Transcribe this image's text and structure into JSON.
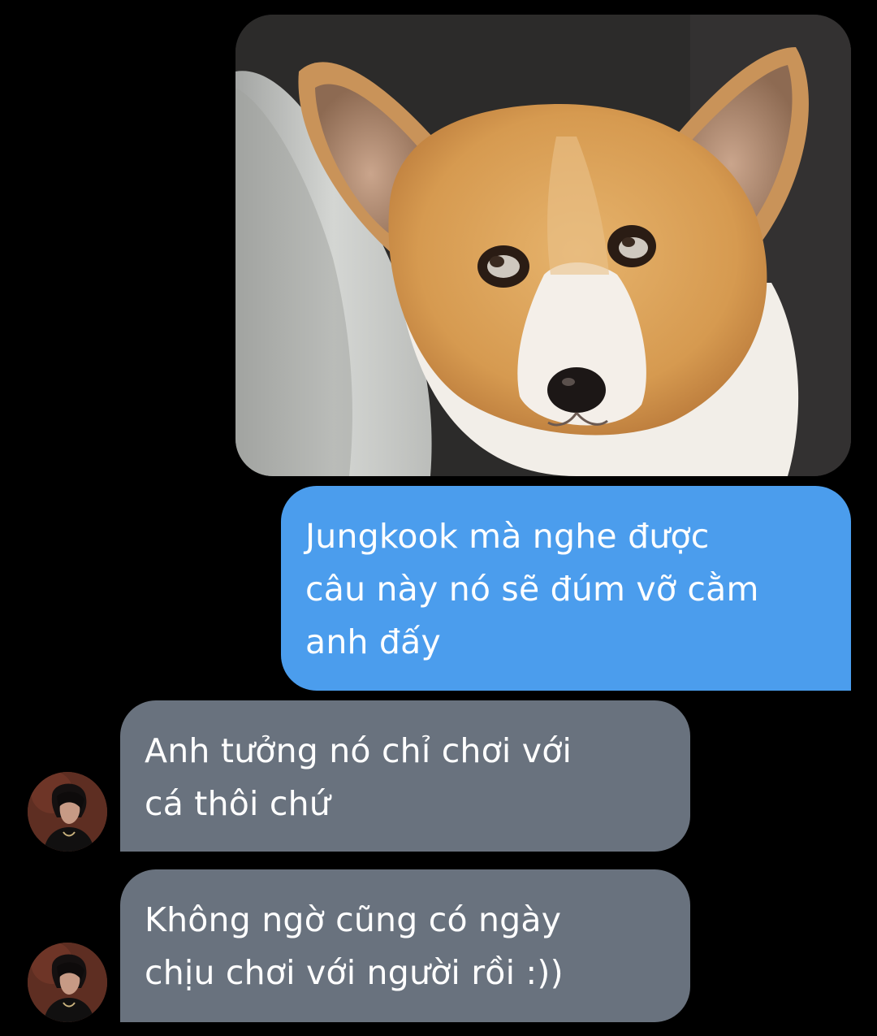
{
  "conversation": {
    "photo_message": {
      "icon": "corgi-photo",
      "direction": "sent"
    },
    "sent_message": {
      "lines": [
        "Jungkook mà nghe được",
        "câu này nó sẽ đúm vỡ cằm",
        "anh đấy"
      ]
    },
    "received_messages": [
      {
        "lines": [
          "Anh tưởng nó chỉ chơi với",
          "cá thôi chứ"
        ]
      },
      {
        "lines": [
          "Không ngờ cũng có ngày",
          "chịu chơi với người rồi :))"
        ]
      }
    ]
  },
  "colors": {
    "background": "#000000",
    "sent_bubble": "#4b9ded",
    "received_bubble": "#69727e",
    "text": "#ffffff"
  }
}
